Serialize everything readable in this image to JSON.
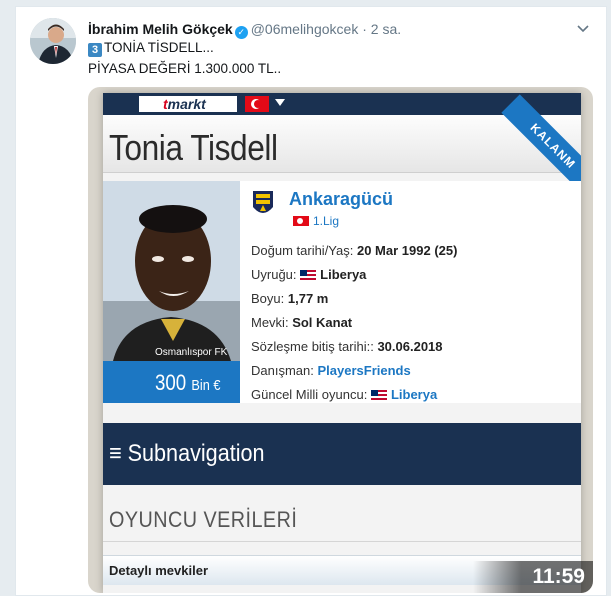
{
  "tweet": {
    "author_name": "İbrahim Melih Gökçek",
    "handle": "@06melihgokcek",
    "separator": "·",
    "time": "2 sa.",
    "line1_badge": "3",
    "line1_text": "TONİA TİSDELL...",
    "line2_text": "PİYASA DEĞERİ 1.300.000 TL.."
  },
  "video": {
    "duration": "11:59",
    "site": {
      "logo_text": "markt",
      "logo_prefix": "t",
      "player_name": "Tonia Tisdell",
      "ribbon_text": "KALANM",
      "photo_caption": "Osmanlıspor FK",
      "market_value": "300",
      "market_unit": "Bin €",
      "club_name": "Ankaragücü",
      "league": "1.Lig",
      "facts": [
        {
          "label": "Doğum tarihi/Yaş:",
          "value": "20 Mar 1992 (25)"
        },
        {
          "label": "Uyruğu:",
          "value": "Liberya"
        },
        {
          "label": "Boyu:",
          "value": "1,77 m"
        },
        {
          "label": "Mevki:",
          "value": "Sol Kanat"
        },
        {
          "label": "Sözleşme bitiş tarihi::",
          "value": "30.06.2018"
        },
        {
          "label": "Danışman:",
          "value": "PlayersFriends"
        },
        {
          "label": "Güncel Milli oyuncu:",
          "value": "Liberya"
        }
      ],
      "subnav_icon": "≡",
      "subnav_text": "Subnavigation",
      "section_heading": "OYUNCU VERİLERİ",
      "detail_row": "Detaylı mevkiler"
    }
  },
  "icons": {
    "verified": "verified-badge-icon",
    "caret": "chevron-down-icon"
  },
  "colors": {
    "accent": "#1da1f2",
    "site_navy": "#1a3151",
    "site_blue": "#1c77c3"
  }
}
